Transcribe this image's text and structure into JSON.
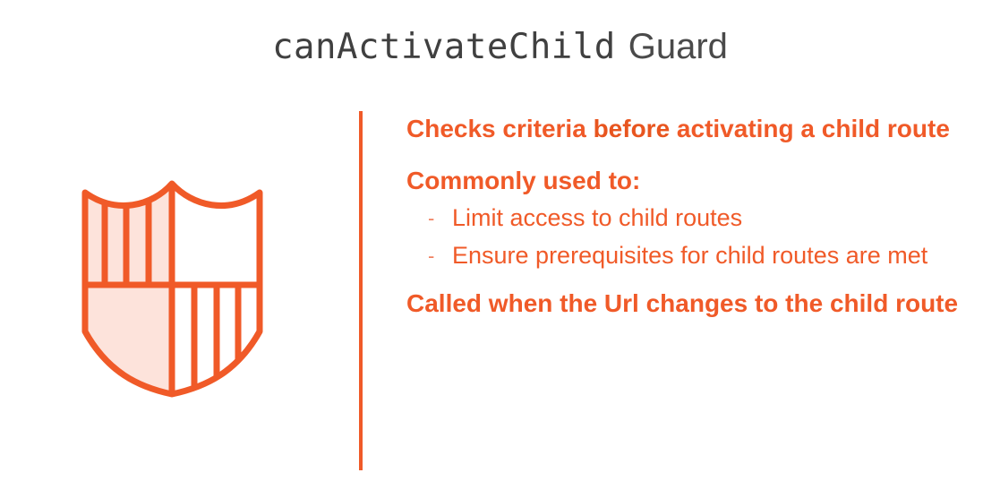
{
  "slide": {
    "title_code": "canActivateChild",
    "title_plain": "Guard",
    "points": {
      "first_pre": "Checks criteria ",
      "first_bold": "before",
      "first_post": " activating a child route",
      "second": "Commonly used to:",
      "bullets": [
        "Limit access to child routes",
        "Ensure prerequisites for child routes are met"
      ],
      "bullet_marker": "-",
      "third": "Called when the Url changes to the child route"
    },
    "icon": "shield-icon",
    "colors": {
      "accent": "#F05A28",
      "accent_fill": "#FDE3DB",
      "title": "#404040"
    }
  }
}
